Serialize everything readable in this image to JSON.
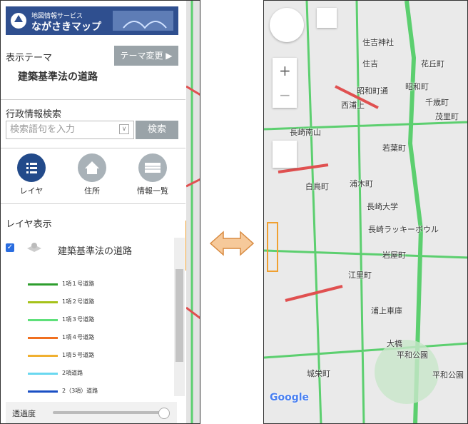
{
  "left_panel": {
    "logo_small": "地図情報サービス",
    "logo_big": "ながさきマップ",
    "theme_label": "表示テーマ",
    "theme_change": "テーマ変更 ▶",
    "theme_name": "建築基準法の道路",
    "search_label": "行政情報検索",
    "search_placeholder": "検索語句を入力",
    "search_button": "検索",
    "nav": [
      {
        "label": "レイヤ"
      },
      {
        "label": "住所"
      },
      {
        "label": "情報一覧"
      }
    ],
    "layer_title": "レイヤ表示",
    "layer_name": "建築基準法の道路",
    "legend": [
      {
        "label": "1項１号道路",
        "color": "#2e9e2e"
      },
      {
        "label": "1項２号道路",
        "color": "#a6c21a"
      },
      {
        "label": "1項３号道路",
        "color": "#5ee07a"
      },
      {
        "label": "1項４号道路",
        "color": "#f07020"
      },
      {
        "label": "1項５号道路",
        "color": "#f0b030"
      },
      {
        "label": "2項道路",
        "color": "#6ad8f0"
      },
      {
        "label": "2（3項）道路",
        "color": "#1a4fc4"
      }
    ],
    "opacity_label": "透過度",
    "collapse": "«"
  },
  "map": {
    "labels": [
      "住吉神社",
      "住吉",
      "花丘町",
      "昭和町通",
      "昭和町",
      "西浦上",
      "千歳町",
      "長崎南山",
      "茂里町",
      "若葉町",
      "白鳥町",
      "浦木町",
      "長崎大学",
      "長崎ラッキーボウル",
      "岩屋町",
      "江里町",
      "浦上車庫",
      "大橋",
      "平和公園",
      "平和公園",
      "城栄町",
      "Google"
    ]
  }
}
